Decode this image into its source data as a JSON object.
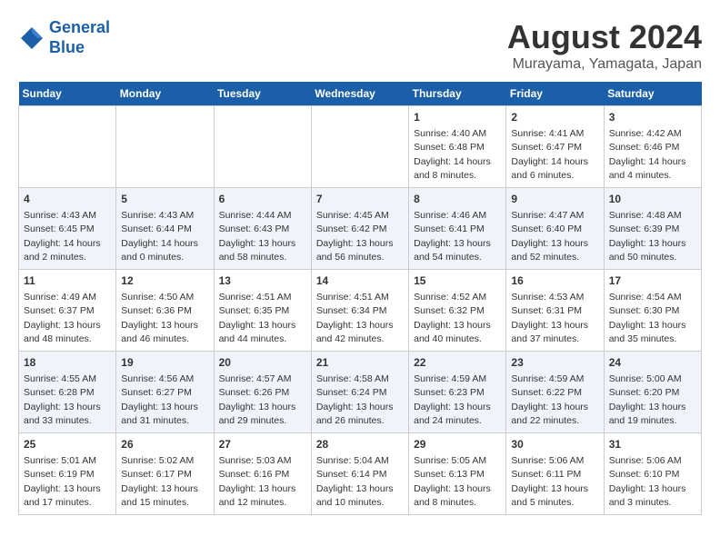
{
  "header": {
    "logo_line1": "General",
    "logo_line2": "Blue",
    "title": "August 2024",
    "subtitle": "Murayama, Yamagata, Japan"
  },
  "weekdays": [
    "Sunday",
    "Monday",
    "Tuesday",
    "Wednesday",
    "Thursday",
    "Friday",
    "Saturday"
  ],
  "weeks": [
    [
      {
        "day": "",
        "info": ""
      },
      {
        "day": "",
        "info": ""
      },
      {
        "day": "",
        "info": ""
      },
      {
        "day": "",
        "info": ""
      },
      {
        "day": "1",
        "info": "Sunrise: 4:40 AM\nSunset: 6:48 PM\nDaylight: 14 hours and 8 minutes."
      },
      {
        "day": "2",
        "info": "Sunrise: 4:41 AM\nSunset: 6:47 PM\nDaylight: 14 hours and 6 minutes."
      },
      {
        "day": "3",
        "info": "Sunrise: 4:42 AM\nSunset: 6:46 PM\nDaylight: 14 hours and 4 minutes."
      }
    ],
    [
      {
        "day": "4",
        "info": "Sunrise: 4:43 AM\nSunset: 6:45 PM\nDaylight: 14 hours and 2 minutes."
      },
      {
        "day": "5",
        "info": "Sunrise: 4:43 AM\nSunset: 6:44 PM\nDaylight: 14 hours and 0 minutes."
      },
      {
        "day": "6",
        "info": "Sunrise: 4:44 AM\nSunset: 6:43 PM\nDaylight: 13 hours and 58 minutes."
      },
      {
        "day": "7",
        "info": "Sunrise: 4:45 AM\nSunset: 6:42 PM\nDaylight: 13 hours and 56 minutes."
      },
      {
        "day": "8",
        "info": "Sunrise: 4:46 AM\nSunset: 6:41 PM\nDaylight: 13 hours and 54 minutes."
      },
      {
        "day": "9",
        "info": "Sunrise: 4:47 AM\nSunset: 6:40 PM\nDaylight: 13 hours and 52 minutes."
      },
      {
        "day": "10",
        "info": "Sunrise: 4:48 AM\nSunset: 6:39 PM\nDaylight: 13 hours and 50 minutes."
      }
    ],
    [
      {
        "day": "11",
        "info": "Sunrise: 4:49 AM\nSunset: 6:37 PM\nDaylight: 13 hours and 48 minutes."
      },
      {
        "day": "12",
        "info": "Sunrise: 4:50 AM\nSunset: 6:36 PM\nDaylight: 13 hours and 46 minutes."
      },
      {
        "day": "13",
        "info": "Sunrise: 4:51 AM\nSunset: 6:35 PM\nDaylight: 13 hours and 44 minutes."
      },
      {
        "day": "14",
        "info": "Sunrise: 4:51 AM\nSunset: 6:34 PM\nDaylight: 13 hours and 42 minutes."
      },
      {
        "day": "15",
        "info": "Sunrise: 4:52 AM\nSunset: 6:32 PM\nDaylight: 13 hours and 40 minutes."
      },
      {
        "day": "16",
        "info": "Sunrise: 4:53 AM\nSunset: 6:31 PM\nDaylight: 13 hours and 37 minutes."
      },
      {
        "day": "17",
        "info": "Sunrise: 4:54 AM\nSunset: 6:30 PM\nDaylight: 13 hours and 35 minutes."
      }
    ],
    [
      {
        "day": "18",
        "info": "Sunrise: 4:55 AM\nSunset: 6:28 PM\nDaylight: 13 hours and 33 minutes."
      },
      {
        "day": "19",
        "info": "Sunrise: 4:56 AM\nSunset: 6:27 PM\nDaylight: 13 hours and 31 minutes."
      },
      {
        "day": "20",
        "info": "Sunrise: 4:57 AM\nSunset: 6:26 PM\nDaylight: 13 hours and 29 minutes."
      },
      {
        "day": "21",
        "info": "Sunrise: 4:58 AM\nSunset: 6:24 PM\nDaylight: 13 hours and 26 minutes."
      },
      {
        "day": "22",
        "info": "Sunrise: 4:59 AM\nSunset: 6:23 PM\nDaylight: 13 hours and 24 minutes."
      },
      {
        "day": "23",
        "info": "Sunrise: 4:59 AM\nSunset: 6:22 PM\nDaylight: 13 hours and 22 minutes."
      },
      {
        "day": "24",
        "info": "Sunrise: 5:00 AM\nSunset: 6:20 PM\nDaylight: 13 hours and 19 minutes."
      }
    ],
    [
      {
        "day": "25",
        "info": "Sunrise: 5:01 AM\nSunset: 6:19 PM\nDaylight: 13 hours and 17 minutes."
      },
      {
        "day": "26",
        "info": "Sunrise: 5:02 AM\nSunset: 6:17 PM\nDaylight: 13 hours and 15 minutes."
      },
      {
        "day": "27",
        "info": "Sunrise: 5:03 AM\nSunset: 6:16 PM\nDaylight: 13 hours and 12 minutes."
      },
      {
        "day": "28",
        "info": "Sunrise: 5:04 AM\nSunset: 6:14 PM\nDaylight: 13 hours and 10 minutes."
      },
      {
        "day": "29",
        "info": "Sunrise: 5:05 AM\nSunset: 6:13 PM\nDaylight: 13 hours and 8 minutes."
      },
      {
        "day": "30",
        "info": "Sunrise: 5:06 AM\nSunset: 6:11 PM\nDaylight: 13 hours and 5 minutes."
      },
      {
        "day": "31",
        "info": "Sunrise: 5:06 AM\nSunset: 6:10 PM\nDaylight: 13 hours and 3 minutes."
      }
    ]
  ]
}
